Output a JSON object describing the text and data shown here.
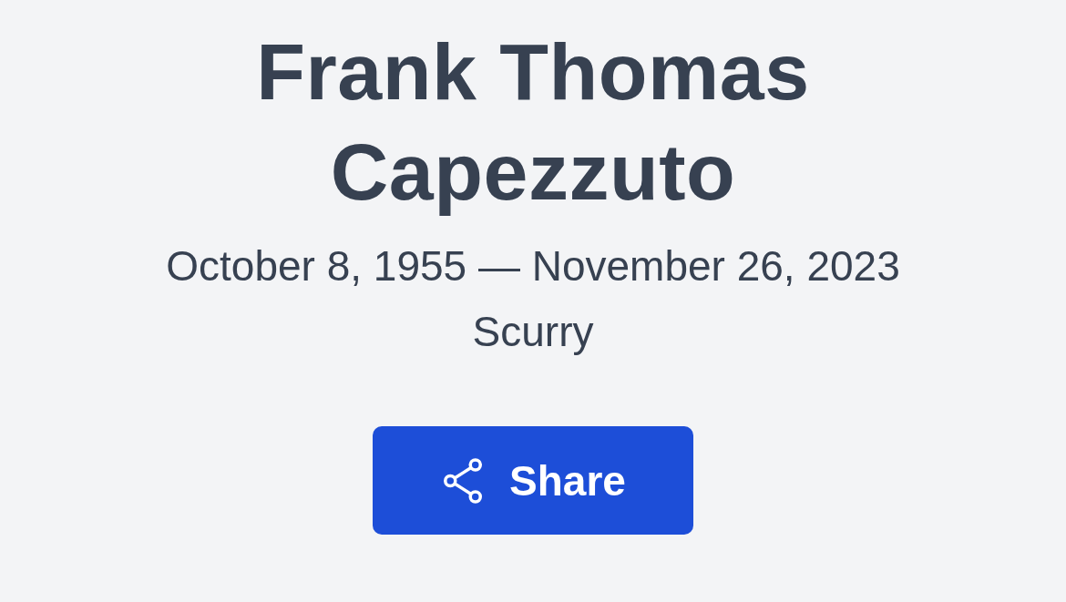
{
  "name": "Frank Thomas Capezzuto",
  "dates": "October 8, 1955 — November 26, 2023",
  "location": "Scurry",
  "share_button": {
    "label": "Share"
  }
}
